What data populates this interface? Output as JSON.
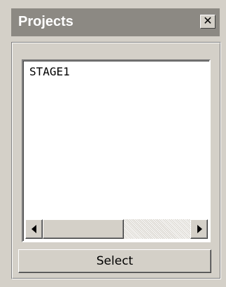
{
  "window": {
    "title": "Projects",
    "close_icon": "close-icon",
    "close_glyph": "✕"
  },
  "list": {
    "items": [
      "STAGE1"
    ]
  },
  "scrollbar": {
    "left_icon": "arrow-left-icon",
    "right_icon": "arrow-right-icon",
    "scroll_position": 0.0
  },
  "buttons": {
    "select_label": "Select"
  },
  "colors": {
    "titlebar": "#8c8983",
    "face": "#d4d0c8"
  }
}
